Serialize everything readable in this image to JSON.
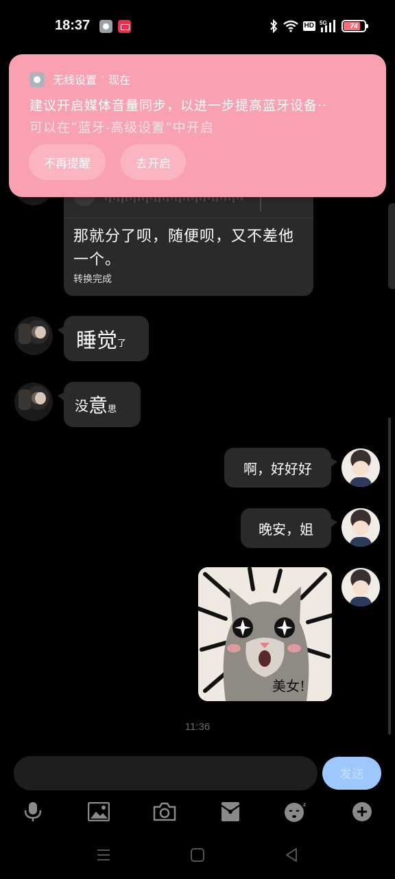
{
  "status_bar": {
    "time": "18:37",
    "hd_label": "HD",
    "network_label": "5G",
    "battery_level": "74",
    "battery_percent": 74
  },
  "notification": {
    "app_name": "无线设置",
    "separator": "·",
    "time": "现在",
    "message_line1": "建议开启媒体音量同步，以进一步提高蓝牙设备··",
    "message_line2": "可以在“蓝牙-高级设置”中开启",
    "dismiss_label": "不再提醒",
    "enable_label": "去开启",
    "background_color": "#f9a1b0"
  },
  "messages": {
    "voice_text": "那就分了呗，随便呗，又不差他一个。",
    "voice_status": "转换完成",
    "msg2_big": "睡觉",
    "msg2_small": "了",
    "msg3_a": "没",
    "msg3_big": "意",
    "msg3_small": "思",
    "msg4": "啊，好好好",
    "msg5": "晚安，姐",
    "sticker_text": "美女!"
  },
  "timestamp": "11:36",
  "input": {
    "value": "",
    "send_label": "发送",
    "send_color": "#9cc7ff"
  },
  "toolbar": {
    "items": [
      "microphone-icon",
      "image-icon",
      "camera-icon",
      "red-packet-icon",
      "sleep-emoji-icon",
      "plus-icon"
    ]
  },
  "nav": {
    "items": [
      "menu-icon",
      "home-icon",
      "back-icon"
    ]
  }
}
